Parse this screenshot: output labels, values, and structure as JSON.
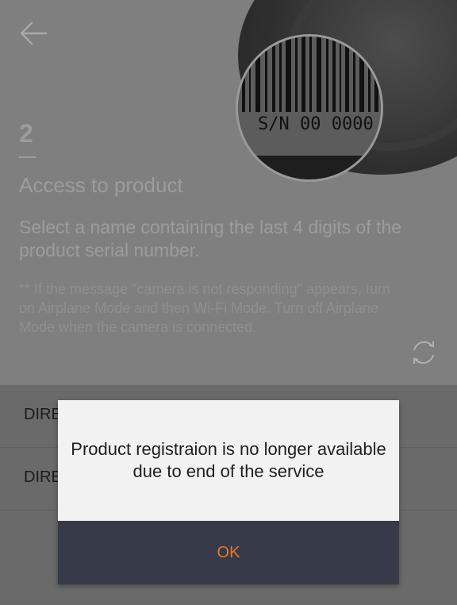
{
  "header": {
    "step_number": "2"
  },
  "content": {
    "heading": "Access to product",
    "description": "Select a name containing the last 4 digits of the product serial number.",
    "note": "** If the message \"camera is not responding\" appears, turn on Airplane Mode and then Wi-Fi Mode. Turn off Airplane Mode when the camera is connected."
  },
  "illustration": {
    "serial_text": "S/N 00 0000"
  },
  "list": {
    "items": [
      {
        "label": "DIRE"
      },
      {
        "label": "DIRE"
      }
    ]
  },
  "dialog": {
    "message": "Product registraion is no longer available due to end of the service",
    "ok_label": "OK"
  },
  "icons": {
    "back": "arrow-left-icon",
    "refresh": "refresh-icon"
  },
  "colors": {
    "accent": "#e8792a",
    "dialog_footer": "#373a48",
    "dialog_body": "#f2f2f2"
  }
}
